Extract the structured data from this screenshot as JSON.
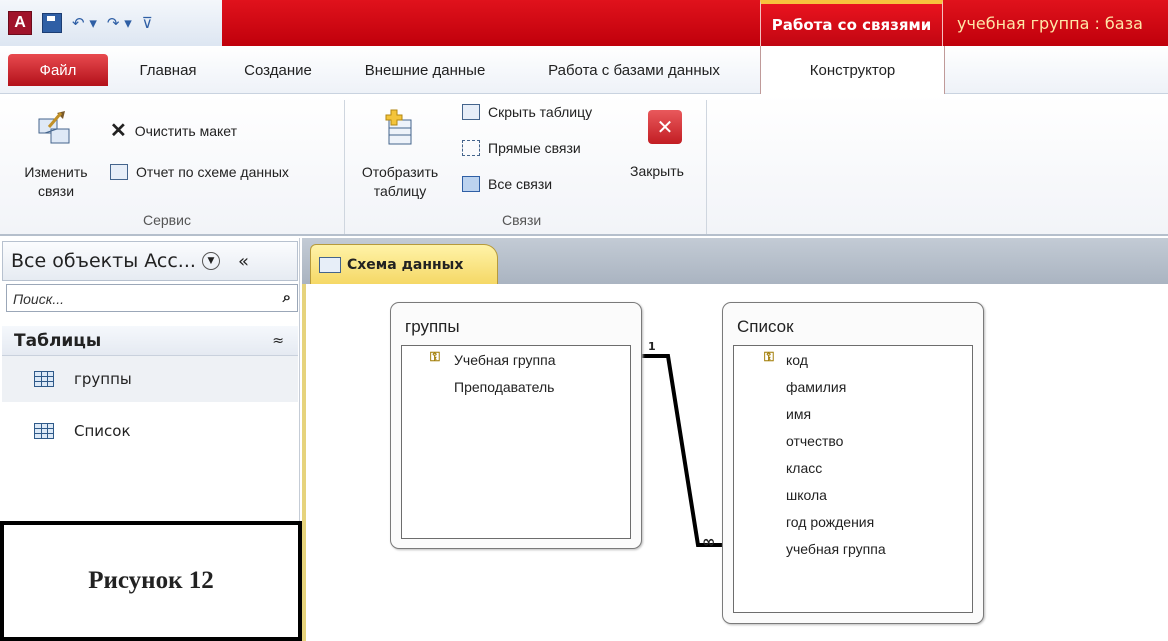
{
  "title_bar": {
    "qat": {
      "app_icon": "A",
      "undo": "↶ ▾",
      "redo": "↷ ▾",
      "customize": "⊽"
    },
    "context_tab_title": "Работа со связями",
    "document_title": "учебная группа : база"
  },
  "ribbon_tabs": [
    "Файл",
    "Главная",
    "Создание",
    "Внешние данные",
    "Работа с базами данных",
    "Конструктор"
  ],
  "ribbon": {
    "service_group": {
      "title": "Сервис",
      "edit_relations": [
        "Изменить",
        "связи"
      ],
      "clear_layout": "Очистить макет",
      "report_schema": "Отчет по схеме данных"
    },
    "relations_group": {
      "title": "Связи",
      "show_table": [
        "Отобразить",
        "таблицу"
      ],
      "hide_table": "Скрыть таблицу",
      "direct_relations": "Прямые связи",
      "all_relations": "Все связи",
      "close": "Закрыть"
    }
  },
  "nav_pane": {
    "header": "Все объекты Acc...",
    "collapse": "«",
    "search_placeholder": "Поиск...",
    "section": "Таблицы",
    "section_toggle": "≈",
    "items": [
      "группы",
      "Список"
    ]
  },
  "caption": "Рисунок 12",
  "document": {
    "tab_label": "Схема данных",
    "tables": [
      {
        "name": "группы",
        "fields": [
          "Учебная группа",
          "Преподаватель"
        ],
        "key_field": 0
      },
      {
        "name": "Список",
        "fields": [
          "код",
          "фамилия",
          "имя",
          "отчество",
          "класс",
          "школа",
          "год рождения",
          "учебная группа"
        ],
        "key_field": 0
      }
    ],
    "relationship": {
      "one_label": "1",
      "many_label": "∞"
    }
  },
  "colors": {
    "title_red": "#d00a14",
    "accent_yellow": "#f5d866",
    "nav_border": "#b7c1cf"
  }
}
